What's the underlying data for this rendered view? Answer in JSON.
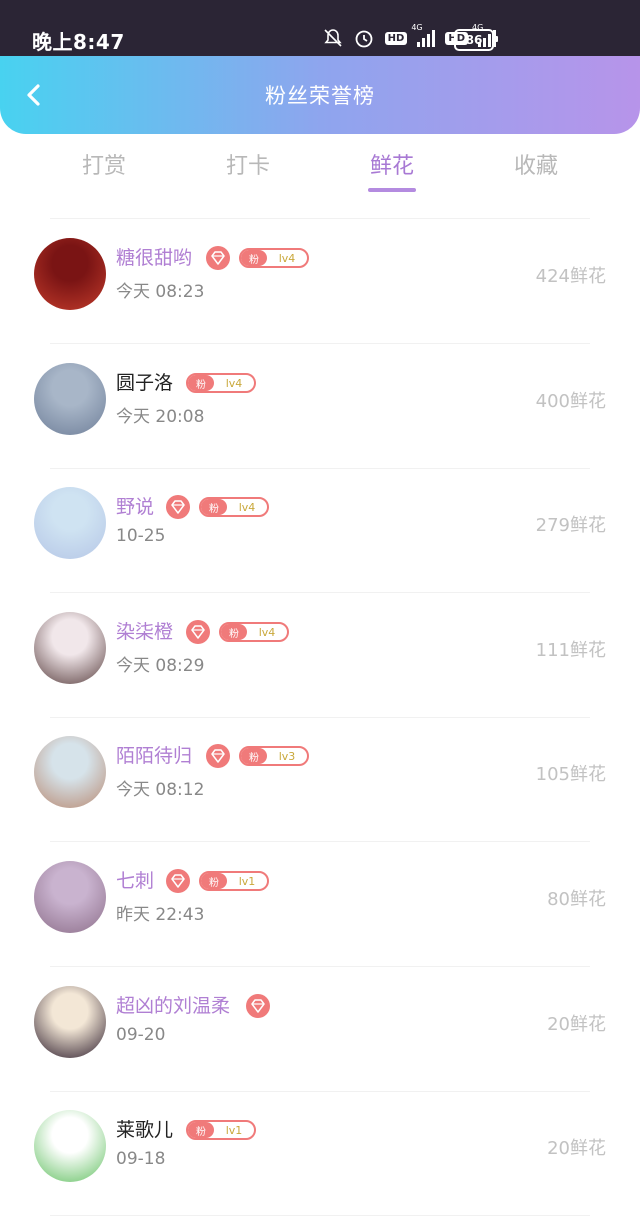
{
  "status_bar": {
    "time": "晚上8:47",
    "icons": [
      "bell-off-icon",
      "alarm-icon",
      "hd-icon",
      "signal-4g-icon",
      "hd-icon",
      "signal-4g-icon"
    ],
    "hd_label": "HD",
    "network_label": "4G",
    "battery": "86"
  },
  "header": {
    "title": "粉丝荣誉榜",
    "back_icon": "chevron-left-icon"
  },
  "tabs": [
    {
      "label": "打赏",
      "active": false
    },
    {
      "label": "打卡",
      "active": false
    },
    {
      "label": "鲜花",
      "active": true
    },
    {
      "label": "收藏",
      "active": false
    }
  ],
  "colors": {
    "accent": "#a879d4",
    "badge": "#f07a7a",
    "header_start": "#48d2f0",
    "header_end": "#b794ea"
  },
  "fan_badge_label": "粉",
  "rows": [
    {
      "name": "糖很甜哟",
      "name_color": "purple",
      "diamond": true,
      "level": "lv4",
      "time": "今天 08:23",
      "count": "424鲜花",
      "avatar": [
        "#7a1414",
        "#c23b2b"
      ]
    },
    {
      "name": "圆子洛",
      "name_color": "dark",
      "diamond": false,
      "level": "lv4",
      "time": "今天 20:08",
      "count": "400鲜花",
      "avatar": [
        "#a8b6c8",
        "#6f7f99"
      ]
    },
    {
      "name": "野说",
      "name_color": "purple",
      "diamond": true,
      "level": "lv4",
      "time": "10-25",
      "count": "279鲜花",
      "avatar": [
        "#cfe3f2",
        "#b5c6e6"
      ]
    },
    {
      "name": "染柒橙",
      "name_color": "purple",
      "diamond": true,
      "level": "lv4",
      "time": "今天 08:29",
      "count": "111鲜花",
      "avatar": [
        "#f1e7ea",
        "#5a4040"
      ]
    },
    {
      "name": "陌陌待归",
      "name_color": "purple",
      "diamond": true,
      "level": "lv3",
      "time": "今天 08:12",
      "count": "105鲜花",
      "avatar": [
        "#d6e3ea",
        "#b88a73"
      ]
    },
    {
      "name": "七刺",
      "name_color": "purple",
      "diamond": true,
      "level": "lv1",
      "time": "昨天 22:43",
      "count": "80鲜花",
      "avatar": [
        "#c9b3cf",
        "#8d6f8a"
      ]
    },
    {
      "name": "超凶的刘温柔",
      "name_color": "purple",
      "diamond": true,
      "level": "",
      "time": "09-20",
      "count": "20鲜花",
      "avatar": [
        "#f3e7d6",
        "#2b1b2b"
      ]
    },
    {
      "name": "莱歌儿",
      "name_color": "dark",
      "diamond": false,
      "level": "lv1",
      "time": "09-18",
      "count": "20鲜花",
      "avatar": [
        "#ffffff",
        "#63c062"
      ]
    }
  ]
}
